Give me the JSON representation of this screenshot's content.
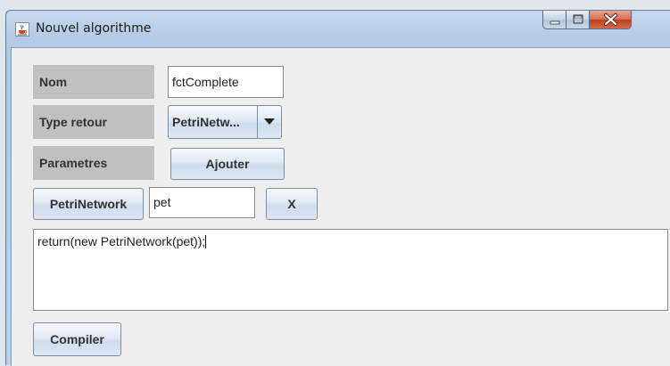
{
  "window": {
    "title": "Nouvel algorithme",
    "app_icon": "java-cup-icon",
    "controls": {
      "minimize_icon": "minimize-icon",
      "maximize_icon": "maximize-icon",
      "close_icon": "close-icon"
    }
  },
  "form": {
    "nom": {
      "label": "Nom",
      "value": "fctComplete"
    },
    "type_retour": {
      "label": "Type retour",
      "selected": "PetriNetw...",
      "arrow_icon": "dropdown-arrow-icon"
    },
    "parametres": {
      "label": "Parametres",
      "add_button": "Ajouter"
    },
    "parameter_row": {
      "type_button": "PetriNetwork",
      "name_value": "pet",
      "remove_button": "X"
    },
    "code": {
      "value": "return(new PetriNetwork(pet));"
    },
    "compile_button": "Compiler"
  },
  "colors": {
    "frame": "#b5cbe6",
    "client_bg": "#eeeeee",
    "label_bg": "#c0c0c0",
    "close_red": "#c0401f"
  }
}
